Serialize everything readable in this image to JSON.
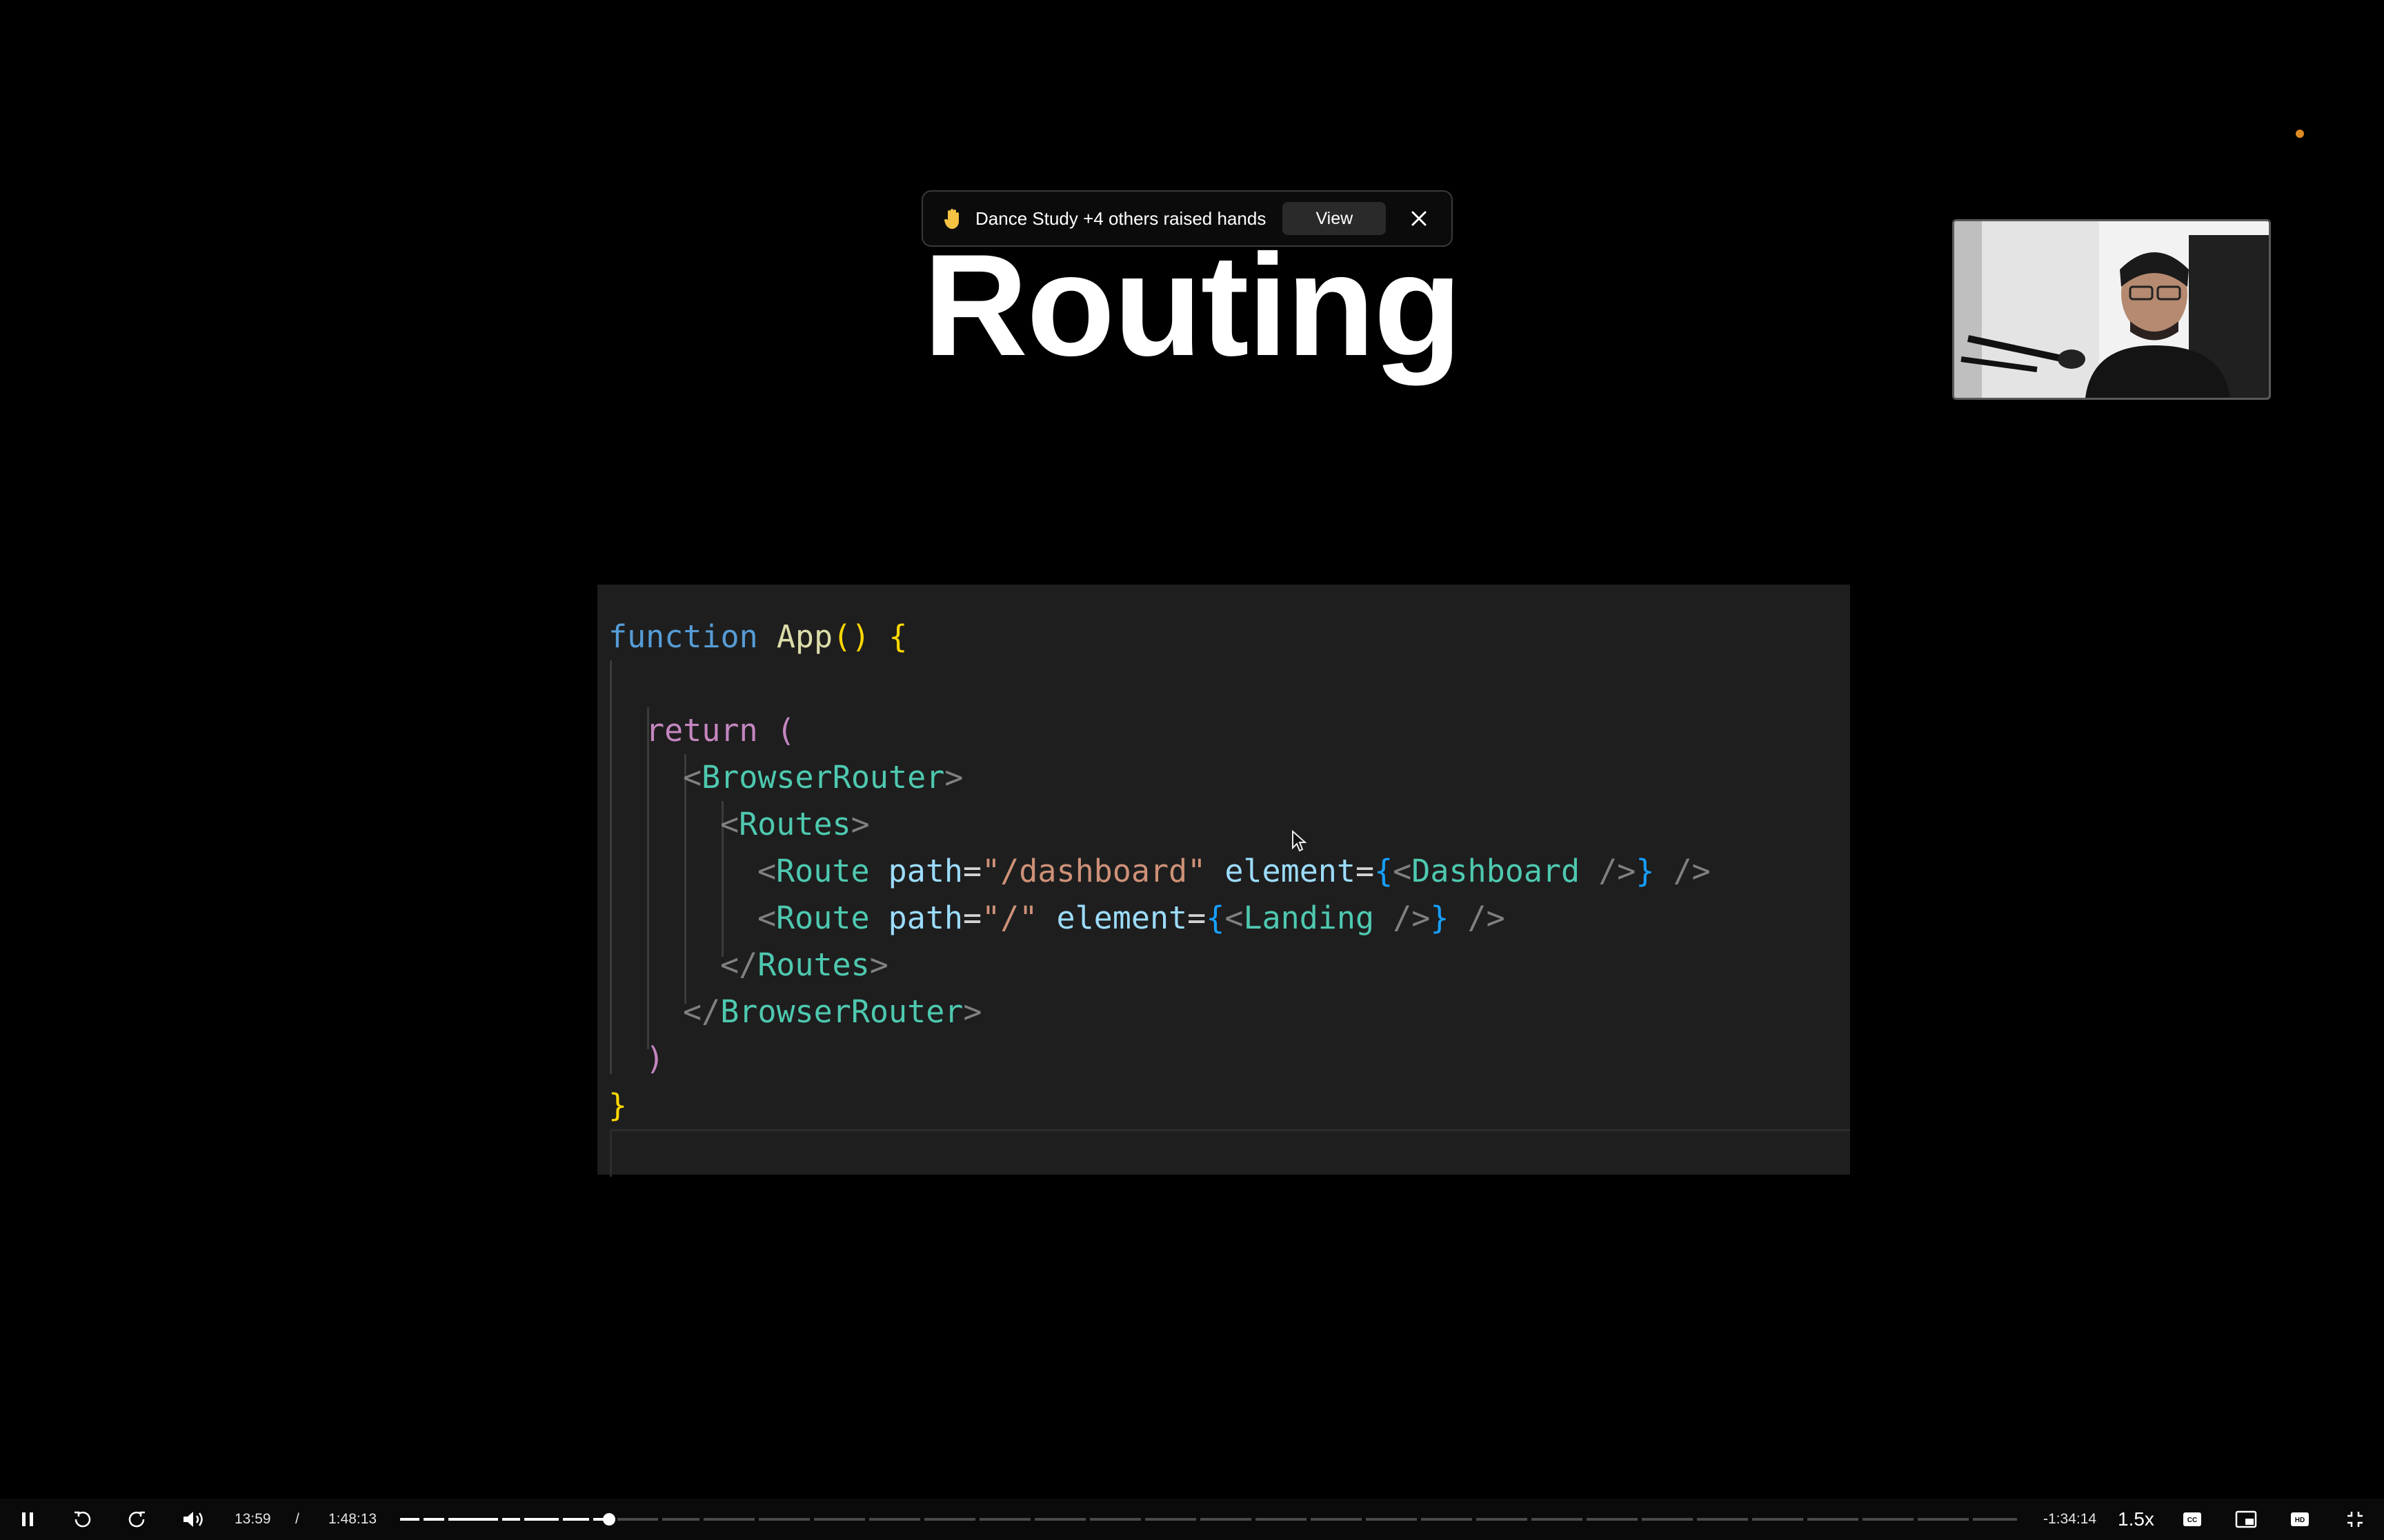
{
  "notification": {
    "hand_icon": "raised-hand-icon",
    "message": "Dance Study +4 others raised hands",
    "view_label": "View",
    "close_icon": "close-icon"
  },
  "slide": {
    "title": "Routing",
    "code": [
      [
        [
          "k",
          "function "
        ],
        [
          "f",
          "App"
        ],
        [
          "y",
          "() {"
        ]
      ],
      [],
      [
        [
          "p",
          "return "
        ],
        [
          "p",
          "("
        ]
      ],
      [
        [
          "g",
          "<"
        ],
        [
          "t",
          "BrowserRouter"
        ],
        [
          "g",
          ">"
        ]
      ],
      [
        [
          "g",
          "<"
        ],
        [
          "t",
          "Routes"
        ],
        [
          "g",
          ">"
        ]
      ],
      [
        [
          "g",
          "<"
        ],
        [
          "t",
          "Route "
        ],
        [
          "a",
          "path"
        ],
        [
          "w",
          "="
        ],
        [
          "s",
          "\"/dashboard\""
        ],
        [
          "w",
          " "
        ],
        [
          "a",
          "element"
        ],
        [
          "w",
          "="
        ],
        [
          "b",
          "{"
        ],
        [
          "g",
          "<"
        ],
        [
          "t",
          "Dashboard "
        ],
        [
          "g",
          "/>"
        ],
        [
          "b",
          "}"
        ],
        [
          "g",
          " />"
        ]
      ],
      [
        [
          "g",
          "<"
        ],
        [
          "t",
          "Route "
        ],
        [
          "a",
          "path"
        ],
        [
          "w",
          "="
        ],
        [
          "s",
          "\"/\""
        ],
        [
          "w",
          " "
        ],
        [
          "a",
          "element"
        ],
        [
          "w",
          "="
        ],
        [
          "b",
          "{"
        ],
        [
          "g",
          "<"
        ],
        [
          "t",
          "Landing "
        ],
        [
          "g",
          "/>"
        ],
        [
          "b",
          "}"
        ],
        [
          "g",
          " />"
        ]
      ],
      [
        [
          "g",
          "</"
        ],
        [
          "t",
          "Routes"
        ],
        [
          "g",
          ">"
        ]
      ],
      [
        [
          "g",
          "</"
        ],
        [
          "t",
          "BrowserRouter"
        ],
        [
          "g",
          ">"
        ]
      ],
      [
        [
          "p",
          ")"
        ]
      ],
      [
        [
          "y",
          "}"
        ]
      ]
    ],
    "code_indent": [
      0,
      0,
      1,
      2,
      3,
      4,
      4,
      3,
      2,
      1,
      0
    ]
  },
  "player": {
    "current_time": "13:59",
    "separator": "/",
    "duration": "1:48:13",
    "remaining": "-1:34:14",
    "speed": "1.5x",
    "progress_fraction": 0.129,
    "icons": [
      "pause-icon",
      "rewind-icon",
      "forward-icon",
      "volume-icon",
      "captions-icon",
      "picture-in-picture-icon",
      "hd-icon",
      "exit-fullscreen-icon"
    ]
  }
}
